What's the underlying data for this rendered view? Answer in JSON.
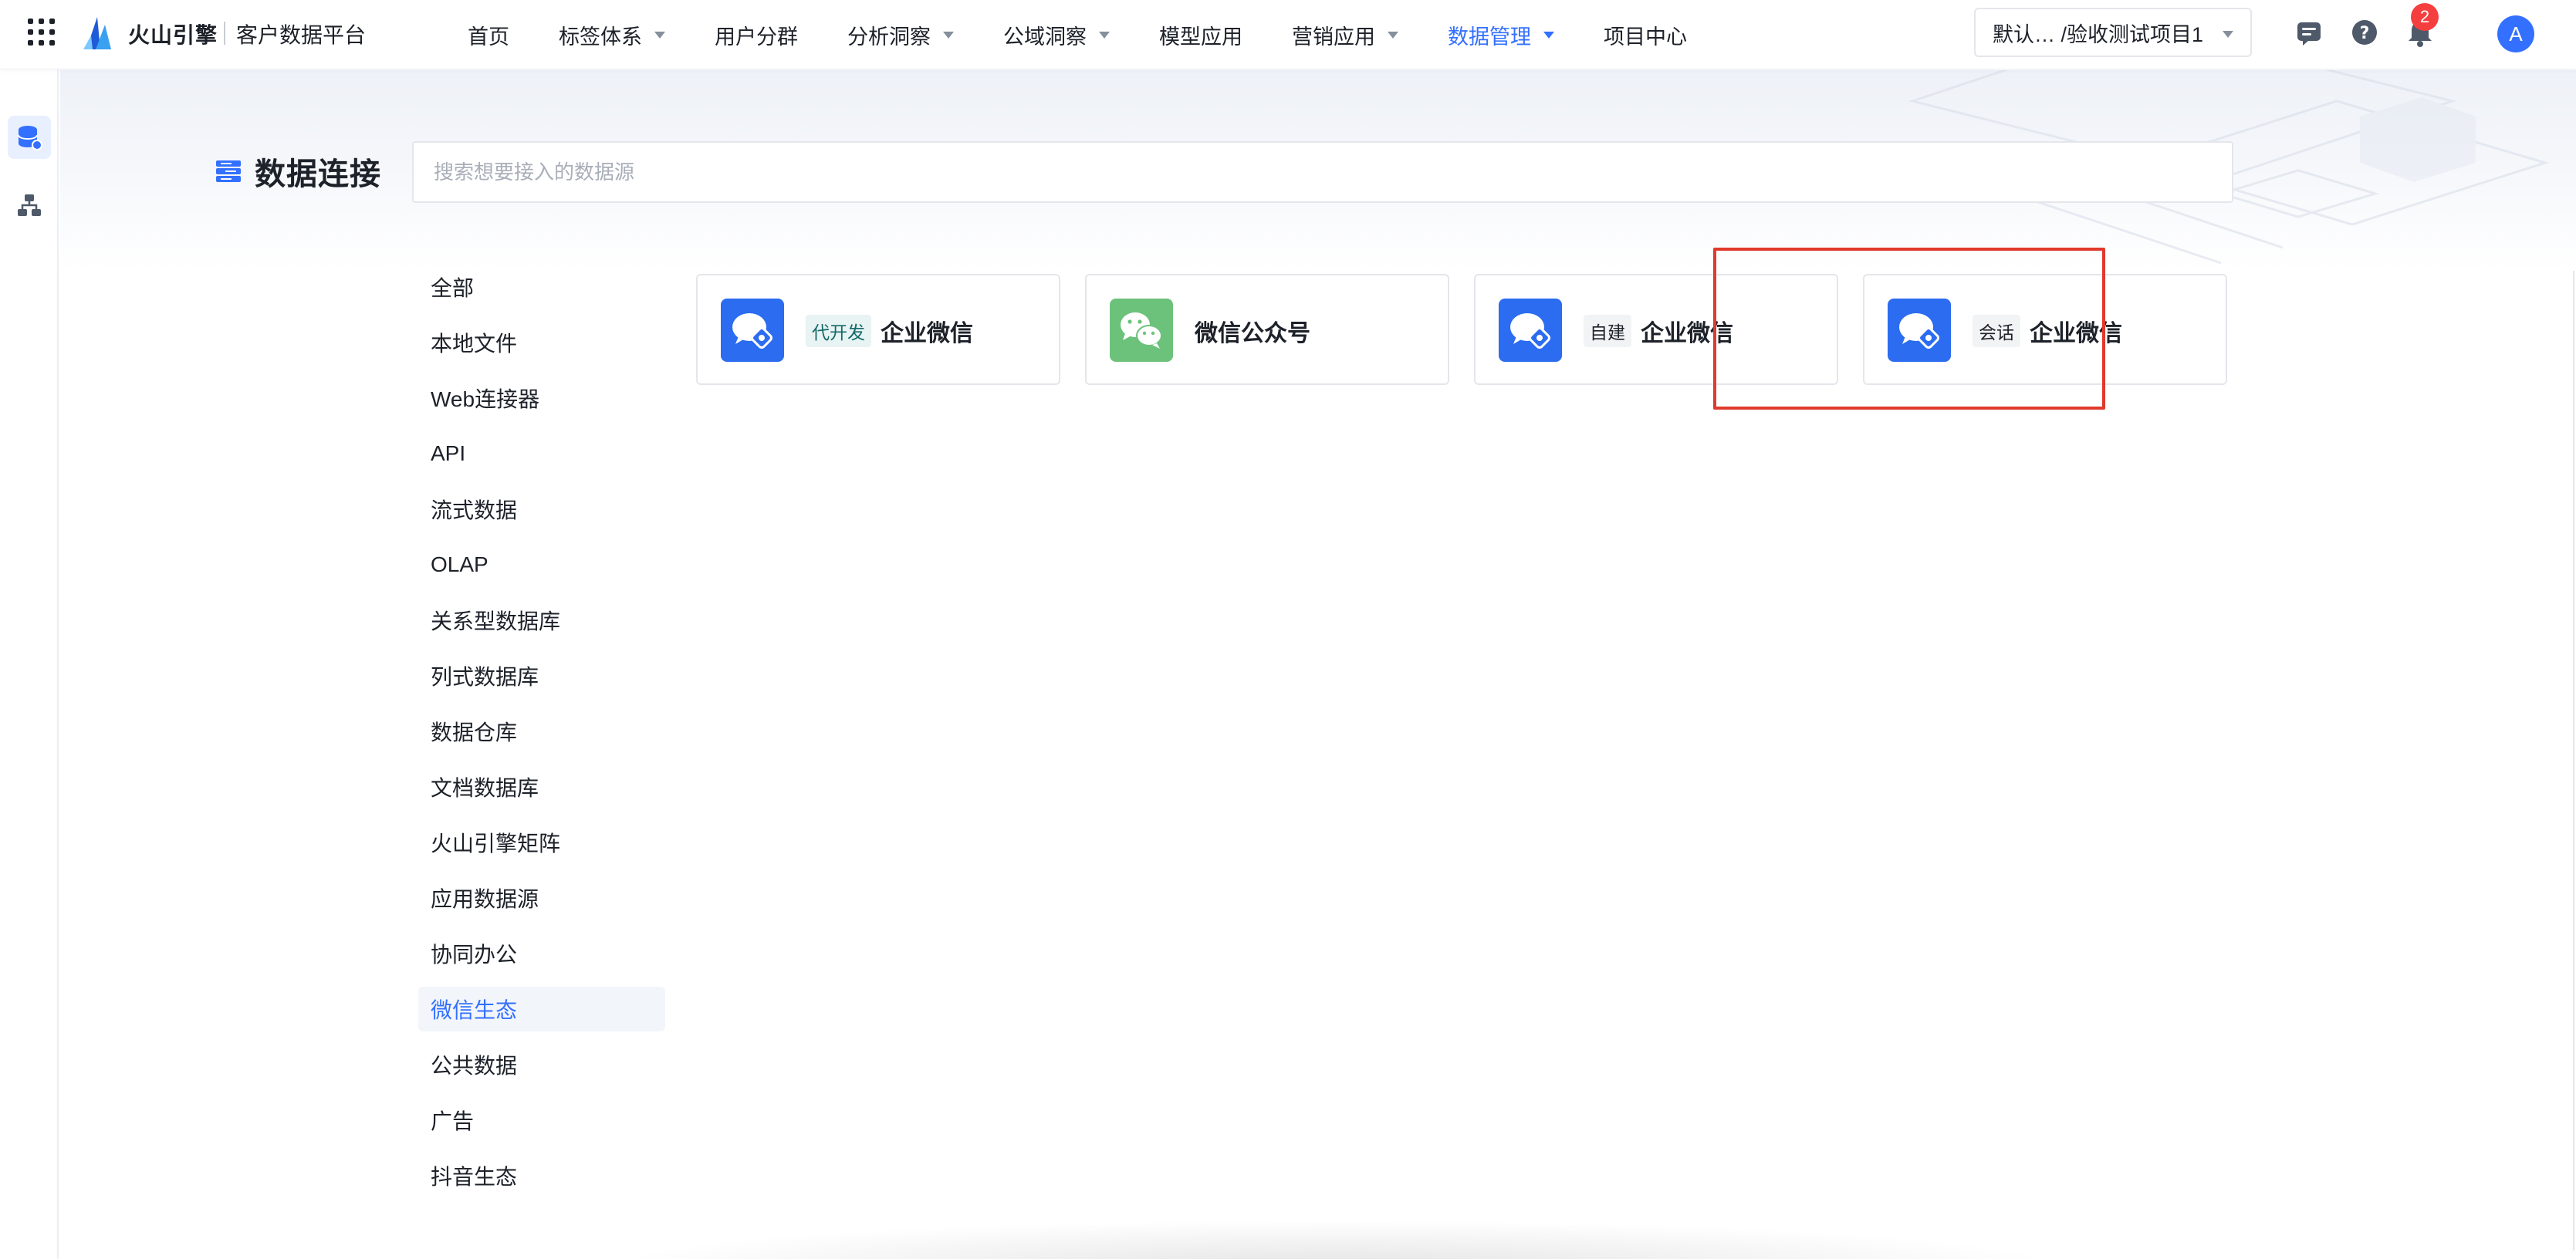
{
  "app": {
    "brand": "火山引擎",
    "product": "客户数据平台"
  },
  "nav": {
    "items": [
      {
        "label": "首页",
        "has_caret": false,
        "active": false
      },
      {
        "label": "标签体系",
        "has_caret": true,
        "active": false
      },
      {
        "label": "用户分群",
        "has_caret": false,
        "active": false
      },
      {
        "label": "分析洞察",
        "has_caret": true,
        "active": false
      },
      {
        "label": "公域洞察",
        "has_caret": true,
        "active": false
      },
      {
        "label": "模型应用",
        "has_caret": false,
        "active": false
      },
      {
        "label": "营销应用",
        "has_caret": true,
        "active": false
      },
      {
        "label": "数据管理",
        "has_caret": true,
        "active": true
      },
      {
        "label": "项目中心",
        "has_caret": false,
        "active": false
      }
    ],
    "project_selector": "默认… /验收测试项目1",
    "notification_count": "2",
    "avatar_letter": "A"
  },
  "page": {
    "title": "数据连接",
    "search_placeholder": "搜索想要接入的数据源"
  },
  "categories": [
    {
      "label": "全部",
      "active": false
    },
    {
      "label": "本地文件",
      "active": false
    },
    {
      "label": "Web连接器",
      "active": false
    },
    {
      "label": "API",
      "active": false
    },
    {
      "label": "流式数据",
      "active": false
    },
    {
      "label": "OLAP",
      "active": false
    },
    {
      "label": "关系型数据库",
      "active": false
    },
    {
      "label": "列式数据库",
      "active": false
    },
    {
      "label": "数据仓库",
      "active": false
    },
    {
      "label": "文档数据库",
      "active": false
    },
    {
      "label": "火山引擎矩阵",
      "active": false
    },
    {
      "label": "应用数据源",
      "active": false
    },
    {
      "label": "协同办公",
      "active": false
    },
    {
      "label": "微信生态",
      "active": true
    },
    {
      "label": "公共数据",
      "active": false
    },
    {
      "label": "广告",
      "active": false
    },
    {
      "label": "抖音生态",
      "active": false
    }
  ],
  "cards": [
    {
      "tag": "代开发",
      "tag_style": "teal",
      "name": "企业微信",
      "icon": "wecom-icon",
      "icon_color": "#2b6cf0"
    },
    {
      "tag": "",
      "tag_style": "",
      "name": "微信公众号",
      "icon": "wechat-icon",
      "icon_color": "#6cc27b"
    },
    {
      "tag": "自建",
      "tag_style": "gray",
      "name": "企业微信",
      "icon": "wecom-icon",
      "icon_color": "#2b6cf0"
    },
    {
      "tag": "会话",
      "tag_style": "gray",
      "name": "企业微信",
      "icon": "wecom-icon",
      "icon_color": "#2b6cf0",
      "highlighted": true
    }
  ],
  "colors": {
    "accent": "#3370ff",
    "highlight_box": "#e03a2c",
    "badge": "#f53f3f"
  }
}
